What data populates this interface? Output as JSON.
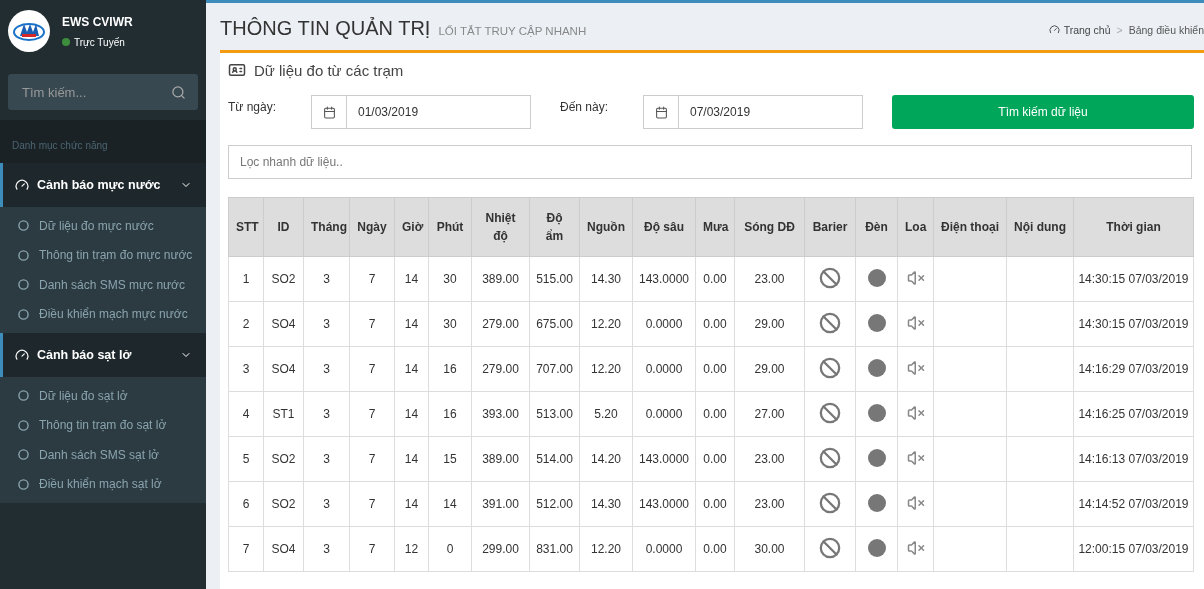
{
  "sidebar": {
    "user": {
      "name": "EWS CVIWR",
      "status": "Trực Tuyến",
      "online": true
    },
    "search": {
      "placeholder": "Tìm kiếm..."
    },
    "section_label": "Danh mục chức năng",
    "groups": [
      {
        "label": "Cảnh báo mực nước",
        "expanded": true,
        "items": [
          "Dữ liệu đo mực nước",
          "Thông tin trạm đo mực nước",
          "Danh sách SMS mực nước",
          "Điều khiển mạch mực nước"
        ]
      },
      {
        "label": "Cảnh báo sạt lở",
        "expanded": true,
        "items": [
          "Dữ liệu đo sạt lở",
          "Thông tin trạm đo sạt lở",
          "Danh sách SMS sạt lở",
          "Điều khiển mạch sạt lở"
        ]
      }
    ]
  },
  "header": {
    "title": "THÔNG TIN QUẢN TRỊ",
    "subtitle": "LỐI TẮT TRUY CẬP NHANH",
    "breadcrumb": [
      "Trang chủ",
      "Bảng điều khiển"
    ],
    "breadcrumb_separator": ">"
  },
  "panel": {
    "title": "Dữ liệu đo từ các trạm",
    "from": {
      "label": "Từ ngày:",
      "value": "01/03/2019"
    },
    "to": {
      "label": "Đến này:",
      "value": "07/03/2019"
    },
    "search_button": "Tìm kiếm dữ liệu",
    "filter": {
      "placeholder": "Lọc nhanh dữ liệu.."
    }
  },
  "table": {
    "columns": [
      "STT",
      "ID",
      "Tháng",
      "Ngày",
      "Giờ",
      "Phút",
      "Nhiệt độ",
      "Độ ẩm",
      "Nguồn",
      "Độ sâu",
      "Mưa",
      "Sóng DĐ",
      "Barier",
      "Đèn",
      "Loa",
      "Điện thoại",
      "Nội dung",
      "Thời gian"
    ],
    "rows": [
      [
        "1",
        "SO2",
        "3",
        "7",
        "14",
        "30",
        "389.00",
        "515.00",
        "14.30",
        "143.0000",
        "0.00",
        "23.00",
        "14:30:15 07/03/2019"
      ],
      [
        "2",
        "SO4",
        "3",
        "7",
        "14",
        "30",
        "279.00",
        "675.00",
        "12.20",
        "0.0000",
        "0.00",
        "29.00",
        "14:30:15 07/03/2019"
      ],
      [
        "3",
        "SO4",
        "3",
        "7",
        "14",
        "16",
        "279.00",
        "707.00",
        "12.20",
        "0.0000",
        "0.00",
        "29.00",
        "14:16:29 07/03/2019"
      ],
      [
        "4",
        "ST1",
        "3",
        "7",
        "14",
        "16",
        "393.00",
        "513.00",
        "5.20",
        "0.0000",
        "0.00",
        "27.00",
        "14:16:25 07/03/2019"
      ],
      [
        "5",
        "SO2",
        "3",
        "7",
        "14",
        "15",
        "389.00",
        "514.00",
        "14.20",
        "143.0000",
        "0.00",
        "23.00",
        "14:16:13 07/03/2019"
      ],
      [
        "6",
        "SO2",
        "3",
        "7",
        "14",
        "14",
        "391.00",
        "512.00",
        "14.30",
        "143.0000",
        "0.00",
        "23.00",
        "14:14:52 07/03/2019"
      ],
      [
        "7",
        "SO4",
        "3",
        "7",
        "12",
        "0",
        "299.00",
        "831.00",
        "12.20",
        "0.0000",
        "0.00",
        "30.00",
        "12:00:15 07/03/2019"
      ]
    ]
  }
}
